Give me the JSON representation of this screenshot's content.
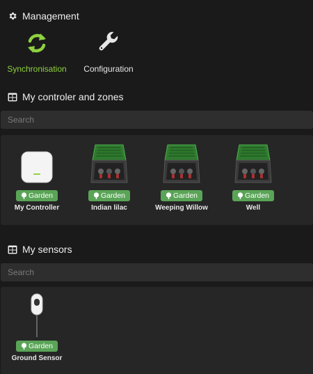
{
  "management": {
    "title": "Management",
    "sync_label": "Synchronisation",
    "config_label": "Configuration"
  },
  "zones": {
    "title": "My controler and zones",
    "search_placeholder": "Search",
    "items": [
      {
        "name": "My Controller",
        "tag": "Garden",
        "icon": "controller-device-icon"
      },
      {
        "name": "Indian lilac",
        "tag": "Garden",
        "icon": "valve-box-icon"
      },
      {
        "name": "Weeping Willow",
        "tag": "Garden",
        "icon": "valve-box-icon"
      },
      {
        "name": "Well",
        "tag": "Garden",
        "icon": "valve-box-icon"
      }
    ]
  },
  "sensors": {
    "title": "My sensors",
    "search_placeholder": "Search",
    "items": [
      {
        "name": "Ground Sensor",
        "tag": "Garden",
        "icon": "ground-sensor-icon"
      }
    ]
  },
  "colors": {
    "accent_green": "#8fd13f",
    "badge_green": "#5aa457",
    "background": "#1a1a1a",
    "panel": "#262626"
  }
}
